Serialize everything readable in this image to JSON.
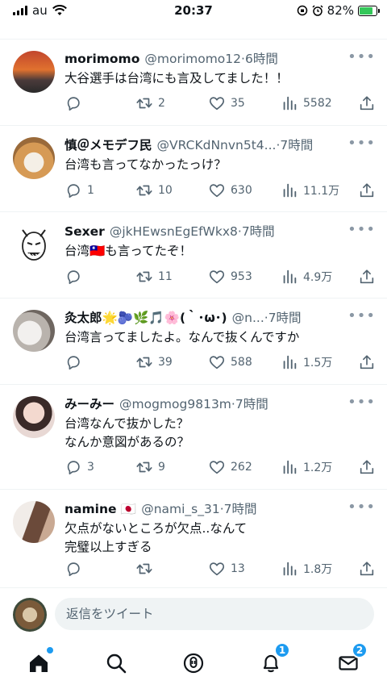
{
  "status_bar": {
    "carrier": "au",
    "time": "20:37",
    "battery": "82%",
    "battery_level": 0.82
  },
  "tweets": [
    {
      "name": "morimomo",
      "handle": "@morimomo12",
      "sep": "·",
      "time": "6時間",
      "lines": [
        "大谷選手は台湾にも言及してました！！"
      ],
      "replies": "",
      "retweets": "2",
      "likes": "35",
      "views": "5582"
    },
    {
      "name": "慎＠メモデフ民",
      "handle": "@VRCKdNnvn5t4...",
      "sep": "·",
      "time": "7時間",
      "lines": [
        "台湾も言ってなかったっけ？"
      ],
      "replies": "1",
      "retweets": "10",
      "likes": "630",
      "views": "11.1万"
    },
    {
      "name": "Sexer",
      "handle": "@jkHEwsnEgEfWkx8",
      "sep": "·",
      "time": "7時間",
      "lines": [
        "台湾🇹🇼も言ってたぞ！"
      ],
      "replies": "",
      "retweets": "11",
      "likes": "953",
      "views": "4.9万"
    },
    {
      "name": "灸太郎🌟🫐🌿🎵🌸(｀･ω･)",
      "handle": "@n...",
      "sep": "·",
      "time": "7時間",
      "lines": [
        "台湾言ってましたよ。なんで抜くんですか"
      ],
      "replies": "",
      "retweets": "39",
      "likes": "588",
      "views": "1.5万"
    },
    {
      "name": "みーみー",
      "handle": "@mogmog9813m",
      "sep": "·",
      "time": "7時間",
      "lines": [
        "台湾なんで抜かした？",
        "なんか意図があるの？"
      ],
      "replies": "3",
      "retweets": "9",
      "likes": "262",
      "views": "1.2万"
    },
    {
      "name": "namine 🇯🇵",
      "handle": "@nami_s_31",
      "sep": "·",
      "time": "7時間",
      "lines": [
        "欠点がないところが欠点..なんて",
        "完璧以上すぎる"
      ],
      "replies": "",
      "retweets": "",
      "likes": "13",
      "views": "1.8万"
    }
  ],
  "more_label": "•••",
  "reply_placeholder": "返信をツイート",
  "tabbar": {
    "home": {
      "icon": "home-icon",
      "dot": true
    },
    "search": {
      "icon": "search-icon"
    },
    "spaces": {
      "icon": "spaces-microphone-icon"
    },
    "notifications": {
      "icon": "bell-icon",
      "badge": "1"
    },
    "messages": {
      "icon": "mail-icon",
      "badge": "2"
    }
  },
  "colors": {
    "accent": "#1d9bf0",
    "text": "#0f1419",
    "secondary": "#536471",
    "divider": "#eff3f4"
  }
}
